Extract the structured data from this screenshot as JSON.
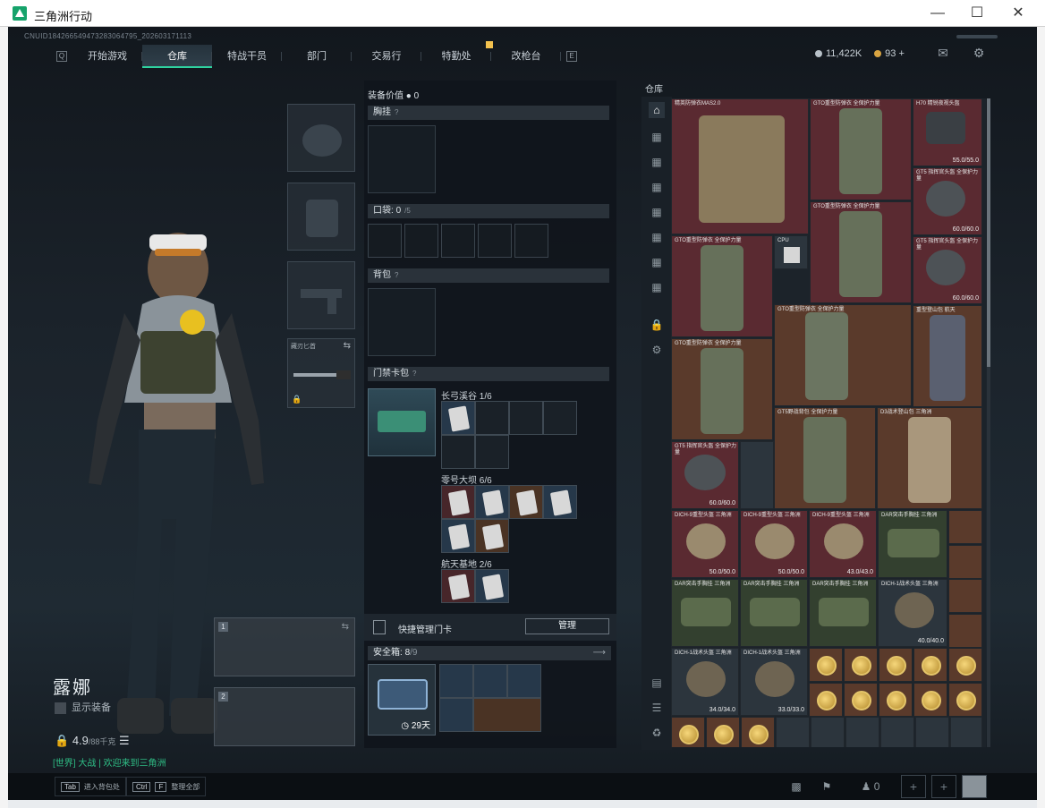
{
  "window": {
    "title": "三角洲行动",
    "minimize_icon": "minimize-icon",
    "maximize_icon": "maximize-icon",
    "close_icon": "close-icon"
  },
  "header": {
    "uid": "CNUID18426654947328306479​5_202603171113",
    "tabs": [
      "开始游戏",
      "仓库",
      "特战干员",
      "部门",
      "交易行",
      "特勤处",
      "改枪台"
    ],
    "active_tab": "仓库",
    "nav_key_left": "Q",
    "nav_key_right": "E",
    "silver": "11,422K",
    "gold": "93",
    "plus": "+"
  },
  "character": {
    "name": "露娜",
    "subtitle": "显示装备",
    "weight": "4.9",
    "weight_max": "/88千克",
    "chat": "[世界] 大战 | 欢迎来到三角洲"
  },
  "equipment": {
    "melee_label": "藏刃匕首",
    "weapon1_num": "1",
    "weapon2_num": "2"
  },
  "middle": {
    "equip_value_label": "装备价值",
    "equip_value": "0",
    "chest_label": "胸挂",
    "pocket_label": "口袋:",
    "pocket_value": "0",
    "pocket_max": "/5",
    "backpack_label": "背包",
    "keycard_label": "门禁卡包",
    "group1": "长弓溪谷 1/6",
    "group2": "零号大坝 6/6",
    "group3": "航天基地 2/6",
    "quick_label": "快捷管理门卡",
    "manage_button": "管理",
    "safe_label": "安全箱:",
    "safe_value": "8",
    "safe_max": "/9",
    "safe_days": "29天"
  },
  "warehouse": {
    "title": "仓库",
    "items": [
      {
        "name": "精英防弹衣MAS2.0"
      },
      {
        "name": "GTO重型防弹衣 全保护力量"
      },
      {
        "name": "H70 精锐夜视头盔",
        "dur": "55.0/55.0"
      },
      {
        "name": "GT5 指挥官头盔 全保护力量",
        "dur": "60.0/60.0"
      },
      {
        "name": "GTO重型防弹衣 全保护力量"
      },
      {
        "name": "CPU"
      },
      {
        "name": "GTO重型防弹衣 全保护力量"
      },
      {
        "name": "GT5 指挥官头盔 全保护力量",
        "dur": "60.0/60.0"
      },
      {
        "name": "GTO重型防弹衣 全保护力量"
      },
      {
        "name": "GTO重型防弹衣 全保护力量"
      },
      {
        "name": "重型登山包 航天"
      },
      {
        "name": "GT5野战背包 全保护力量"
      },
      {
        "name": "GT5野战背包 全保护力量"
      },
      {
        "name": "D3战术登山包 三角洲"
      },
      {
        "name": "GT5 指挥官头盔 全保护力量",
        "dur": "60.0/60.0"
      },
      {
        "name": "DICH-9重型头盔 三角洲",
        "dur": "50.0/50.0"
      },
      {
        "name": "DICH-9重型头盔 三角洲",
        "dur": "50.0/50.0"
      },
      {
        "name": "DICH-9重型头盔 三角洲",
        "dur": "43.0/43.0"
      },
      {
        "name": "DAR突击手胸挂 三角洲"
      },
      {
        "name": "DAR突击手胸挂 三角洲"
      },
      {
        "name": "DAR突击手胸挂 三角洲"
      },
      {
        "name": "DAR突击手胸挂 三角洲"
      },
      {
        "name": "DICH-1战术头盔 三角洲",
        "dur": "40.0/40.0"
      },
      {
        "name": "DICH-1战术头盔 三角洲",
        "dur": "34.0/34.0"
      },
      {
        "name": "DICH-1战术头盔 三角洲",
        "dur": "33.0/33.0"
      }
    ]
  },
  "bottom": {
    "hint1_key": "Tab",
    "hint1_text": "进入背包处",
    "hint2_key": "Ctrl",
    "hint2_key2": "F",
    "hint2_text": "整理全部",
    "friends": "0"
  }
}
